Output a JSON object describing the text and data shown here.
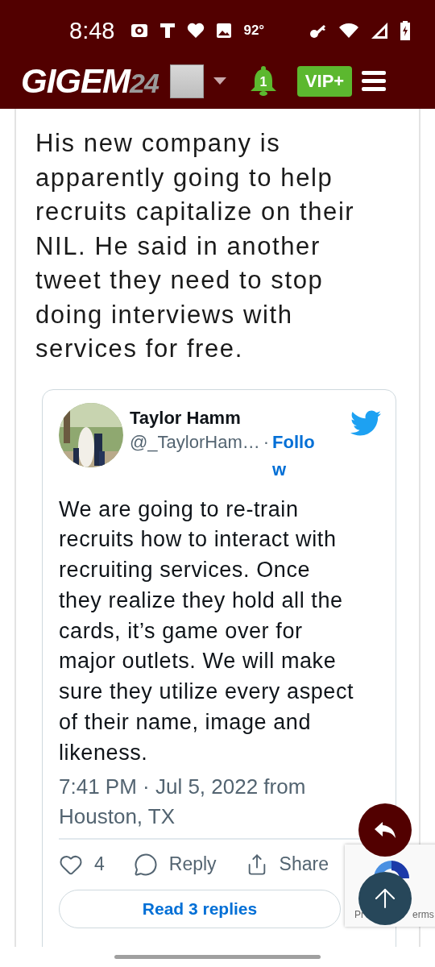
{
  "status_bar": {
    "time": "8:48",
    "temperature": "92°"
  },
  "header": {
    "logo": {
      "main": "GIGEM",
      "suffix": "24"
    },
    "notifications": "1",
    "vip_button": "VIP+"
  },
  "post": {
    "text": "His new company is apparently going to help recruits capitalize on their NIL. He said in another tweet they need to stop doing interviews with services for free.",
    "tweet": {
      "name": "Taylor Hamm",
      "handle": "@_TaylorHam…",
      "separator": "·",
      "follow": "Follow",
      "text": "We are going to re-train recruits how to interact with recruiting services. Once they realize they hold all the cards, it’s game over for major outlets. We will make sure they utilize every aspect of their name, image and likeness.",
      "timestamp": "7:41 PM · Jul 5, 2022 from Houston, TX",
      "likes": "4",
      "reply": "Reply",
      "share": "Share",
      "read_replies": "Read 3 replies"
    }
  },
  "recaptcha": {
    "privacy": "Pr",
    "terms": "erms"
  }
}
